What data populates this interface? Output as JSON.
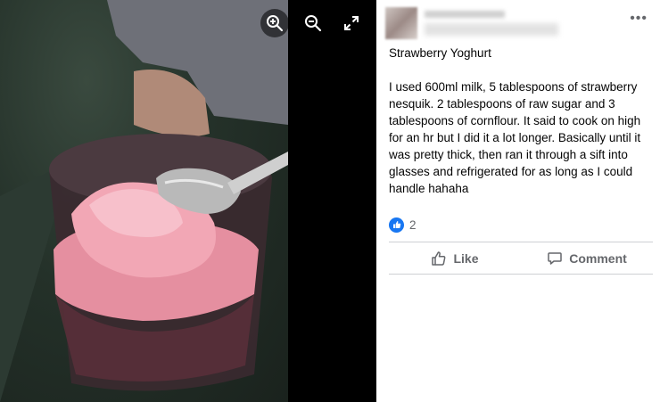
{
  "viewer": {
    "tools": {
      "zoom_in_icon": "zoom-in-icon",
      "zoom_out_icon": "zoom-out-icon",
      "fullscreen_icon": "expand-icon"
    }
  },
  "post": {
    "title": "Strawberry Yoghurt",
    "body": "I used 600ml milk, 5 tablespoons of strawberry nesquik. 2 tablespoons of raw sugar and 3 tablespoons of cornflour. It said to cook on high for an hr but I did it a lot longer. Basically until it was pretty thick, then ran it through a sift into glasses and refrigerated for as long as I could handle hahaha",
    "reaction_count": "2",
    "like_label": "Like",
    "comment_label": "Comment",
    "more_label": "•••"
  },
  "colors": {
    "accent": "#1877f2",
    "secondary_text": "#65676b"
  }
}
